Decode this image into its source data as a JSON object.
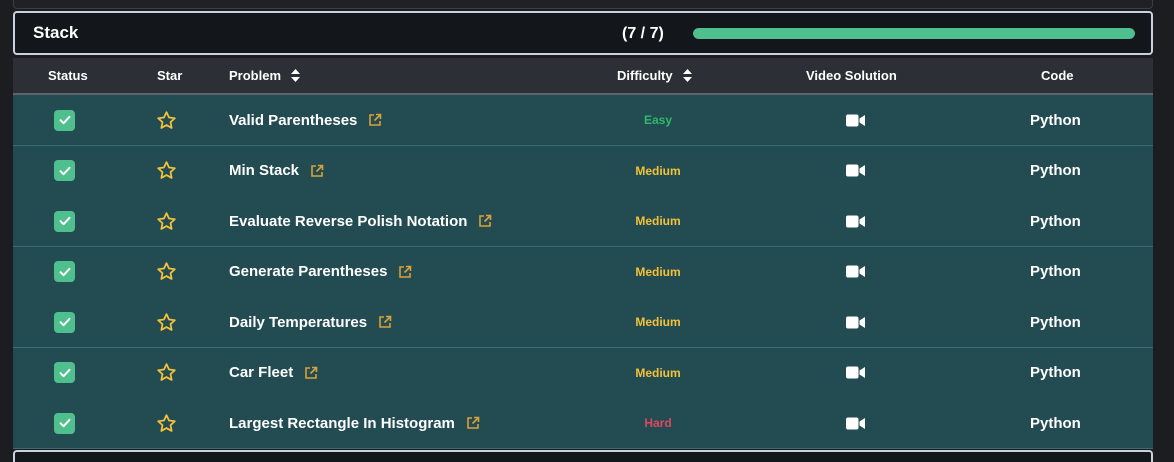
{
  "section": {
    "title": "Stack",
    "count_label": "(7 / 7)",
    "progress": 1.0,
    "progress_color": "#4fc08d"
  },
  "table": {
    "headers": {
      "status": "Status",
      "star": "Star",
      "problem": "Problem",
      "difficulty": "Difficulty",
      "video": "Video Solution",
      "code": "Code"
    },
    "rows": [
      {
        "name": "Valid Parentheses",
        "difficulty": "Easy",
        "code": "Python",
        "done": true
      },
      {
        "name": "Min Stack",
        "difficulty": "Medium",
        "code": "Python",
        "done": true
      },
      {
        "name": "Evaluate Reverse Polish Notation",
        "difficulty": "Medium",
        "code": "Python",
        "done": true
      },
      {
        "name": "Generate Parentheses",
        "difficulty": "Medium",
        "code": "Python",
        "done": true
      },
      {
        "name": "Daily Temperatures",
        "difficulty": "Medium",
        "code": "Python",
        "done": true
      },
      {
        "name": "Car Fleet",
        "difficulty": "Medium",
        "code": "Python",
        "done": true
      },
      {
        "name": "Largest Rectangle In Histogram",
        "difficulty": "Hard",
        "code": "Python",
        "done": true
      }
    ]
  },
  "colors": {
    "easy": "#2fb86b",
    "medium": "#f4c13a",
    "hard": "#e0475f",
    "star": "#f4c13a",
    "link_icon": "#d9a13a",
    "checkbox": "#4fc08d",
    "row_bg": "#224c52"
  },
  "icons": {
    "status": "checkbox-checked-icon",
    "star": "star-outline-icon",
    "link": "external-link-icon",
    "video": "video-camera-icon",
    "sort": "sort-icon"
  }
}
